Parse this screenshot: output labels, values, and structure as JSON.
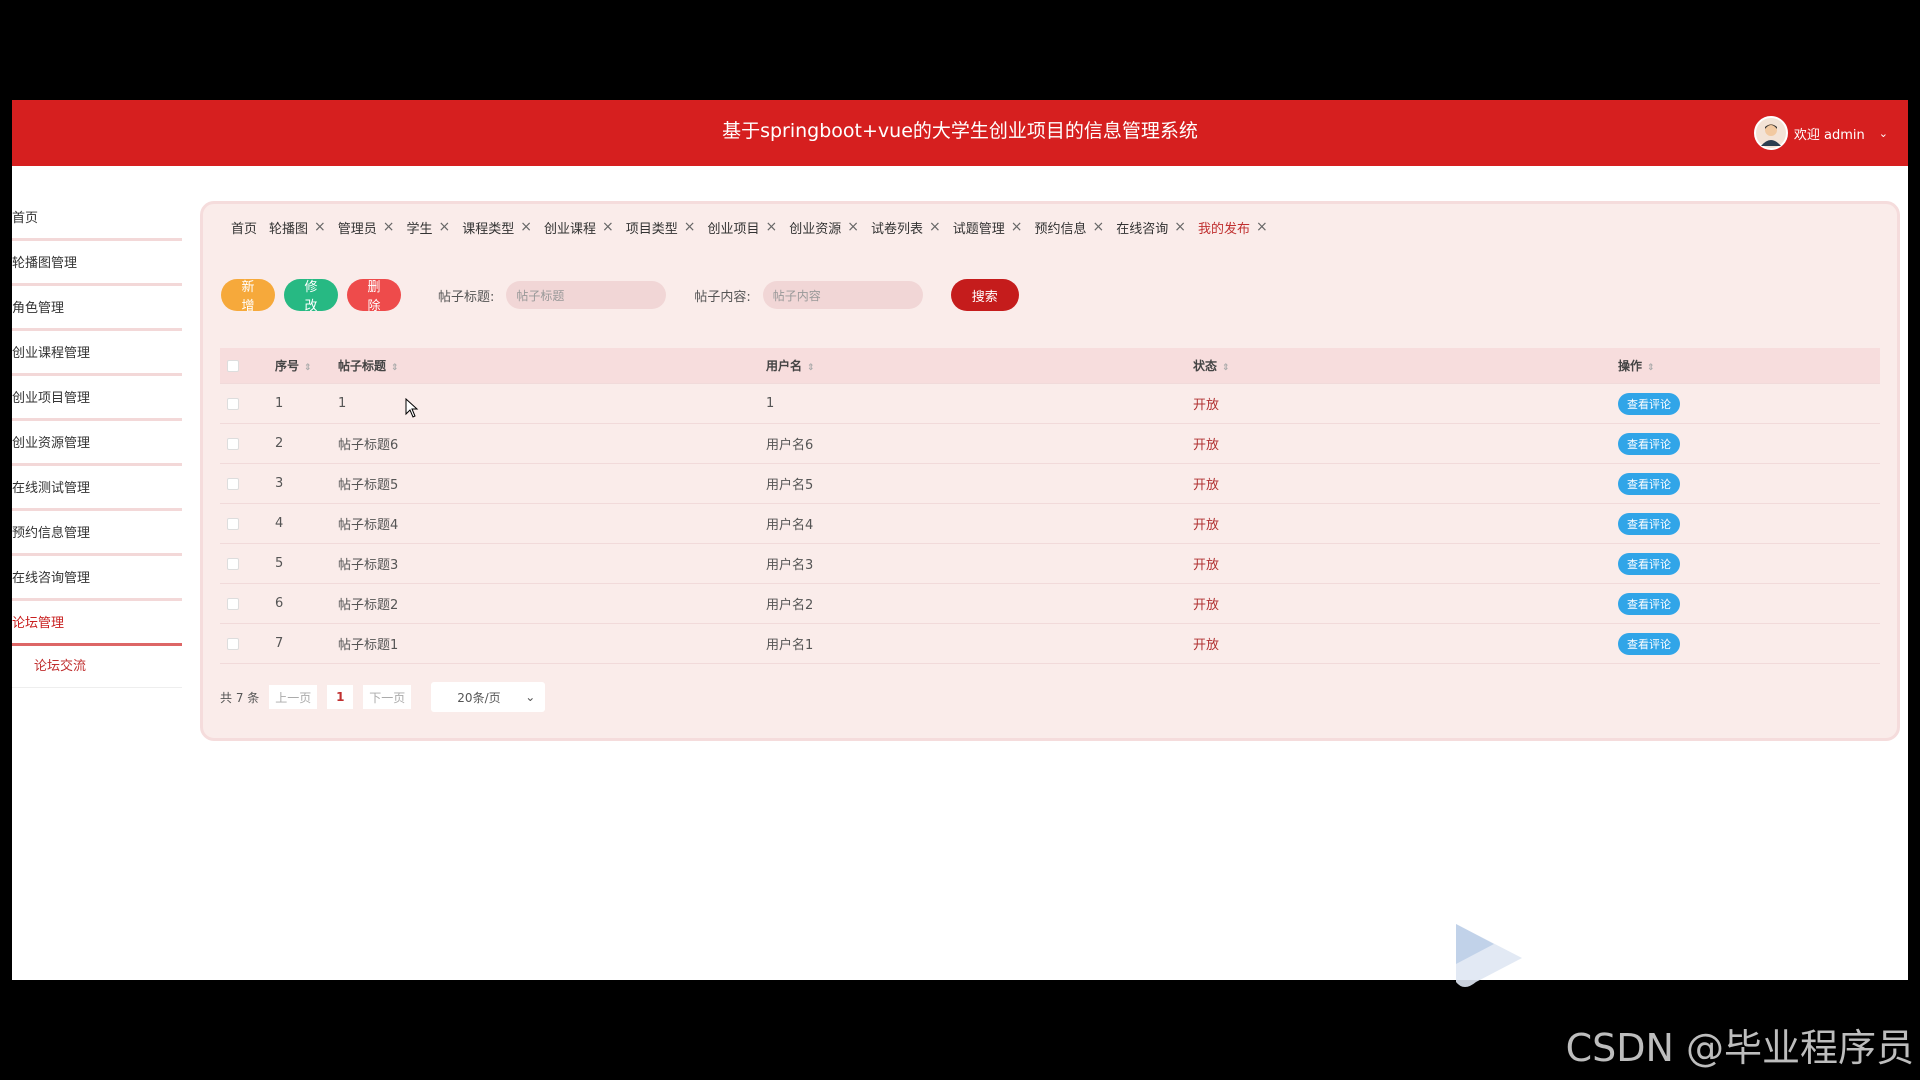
{
  "header": {
    "title": "基于springboot+vue的大学生创业项目的信息管理系统",
    "user_label": "欢迎 admin"
  },
  "sidebar": {
    "items": [
      {
        "label": "首页"
      },
      {
        "label": "轮播图管理"
      },
      {
        "label": "角色管理"
      },
      {
        "label": "创业课程管理"
      },
      {
        "label": "创业项目管理"
      },
      {
        "label": "创业资源管理"
      },
      {
        "label": "在线测试管理"
      },
      {
        "label": "预约信息管理"
      },
      {
        "label": "在线咨询管理"
      },
      {
        "label": "论坛管理"
      }
    ],
    "sub_item": "论坛交流"
  },
  "tabs": [
    {
      "label": "首页",
      "closable": false
    },
    {
      "label": "轮播图",
      "closable": true
    },
    {
      "label": "管理员",
      "closable": true
    },
    {
      "label": "学生",
      "closable": true
    },
    {
      "label": "课程类型",
      "closable": true
    },
    {
      "label": "创业课程",
      "closable": true
    },
    {
      "label": "项目类型",
      "closable": true
    },
    {
      "label": "创业项目",
      "closable": true
    },
    {
      "label": "创业资源",
      "closable": true
    },
    {
      "label": "试卷列表",
      "closable": true
    },
    {
      "label": "试题管理",
      "closable": true
    },
    {
      "label": "预约信息",
      "closable": true
    },
    {
      "label": "在线咨询",
      "closable": true
    },
    {
      "label": "我的发布",
      "closable": true,
      "active": true
    }
  ],
  "toolbar": {
    "add_label": "新增",
    "edit_label": "修改",
    "delete_label": "删除",
    "title_label": "帖子标题:",
    "title_placeholder": "帖子标题",
    "content_label": "帖子内容:",
    "content_placeholder": "帖子内容",
    "search_label": "搜索"
  },
  "table": {
    "headers": [
      "序号",
      "帖子标题",
      "用户名",
      "状态",
      "操作"
    ],
    "rows": [
      {
        "no": "1",
        "title": "1",
        "user": "1",
        "status": "开放",
        "action": "查看评论"
      },
      {
        "no": "2",
        "title": "帖子标题6",
        "user": "用户名6",
        "status": "开放",
        "action": "查看评论"
      },
      {
        "no": "3",
        "title": "帖子标题5",
        "user": "用户名5",
        "status": "开放",
        "action": "查看评论"
      },
      {
        "no": "4",
        "title": "帖子标题4",
        "user": "用户名4",
        "status": "开放",
        "action": "查看评论"
      },
      {
        "no": "5",
        "title": "帖子标题3",
        "user": "用户名3",
        "status": "开放",
        "action": "查看评论"
      },
      {
        "no": "6",
        "title": "帖子标题2",
        "user": "用户名2",
        "status": "开放",
        "action": "查看评论"
      },
      {
        "no": "7",
        "title": "帖子标题1",
        "user": "用户名1",
        "status": "开放",
        "action": "查看评论"
      }
    ]
  },
  "pager": {
    "total": "共 7 条",
    "prev": "上一页",
    "current": "1",
    "next": "下一页",
    "page_size": "20条/页"
  },
  "watermark": "CSDN @毕业程序员",
  "colors": {
    "header": "#d61f1f",
    "panel": "#faecea",
    "add": "#f6a93b",
    "edit": "#27b983",
    "delete": "#ee4b4b",
    "search": "#c51c1c",
    "view": "#31a5e8"
  }
}
